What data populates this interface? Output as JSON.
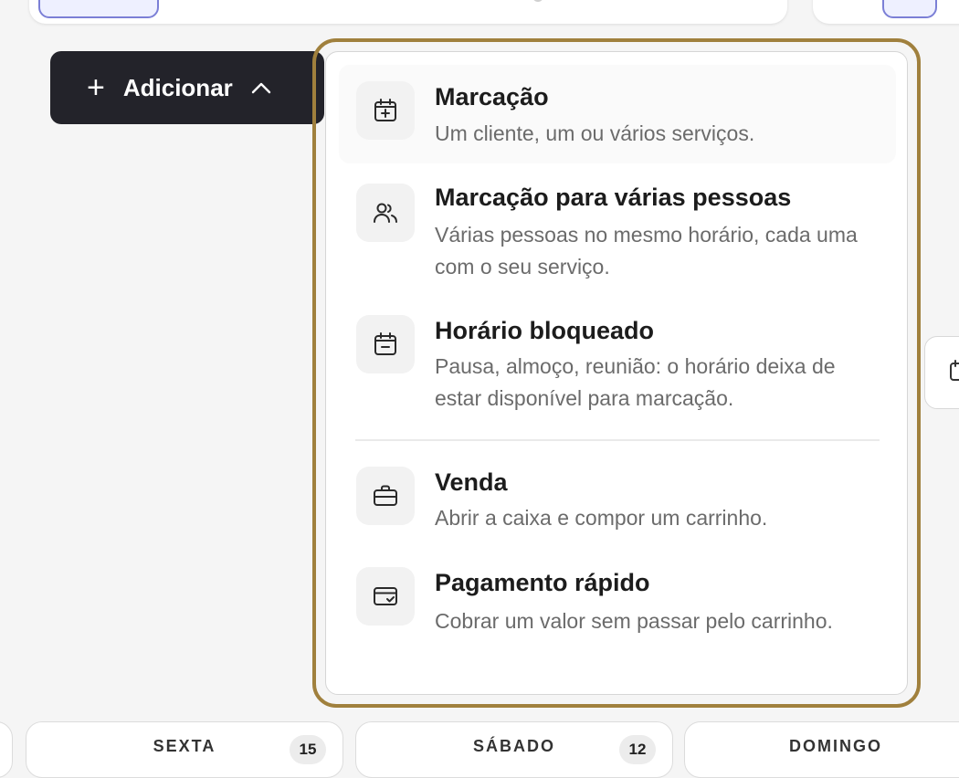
{
  "add_button": {
    "label": "Adicionar"
  },
  "menu": {
    "items": [
      {
        "title": "Marcação",
        "description": "Um cliente, um ou vários serviços.",
        "icon": "calendar-plus-icon"
      },
      {
        "title": "Marcação para várias pessoas",
        "description": "Várias pessoas no mesmo horário, cada uma com o seu serviço.",
        "icon": "users-icon"
      },
      {
        "title": "Horário bloqueado",
        "description": "Pausa, almoço, reunião: o horário deixa de estar disponível para marcação.",
        "icon": "calendar-minus-icon"
      },
      {
        "title": "Venda",
        "description": "Abrir a caixa e compor um carrinho.",
        "icon": "briefcase-icon"
      },
      {
        "title": "Pagamento rápido",
        "description": "Cobrar um valor sem passar pelo carrinho.",
        "icon": "credit-card-check-icon"
      }
    ]
  },
  "day_cards": [
    {
      "label": "SEXTA",
      "count": "15"
    },
    {
      "label": "SÁBADO",
      "count": "12"
    },
    {
      "label": "DOMINGO",
      "count": ""
    }
  ],
  "colors": {
    "accent_outline": "#a0803d",
    "button_bg": "#23232a",
    "pill_border": "#7b7fd6"
  }
}
